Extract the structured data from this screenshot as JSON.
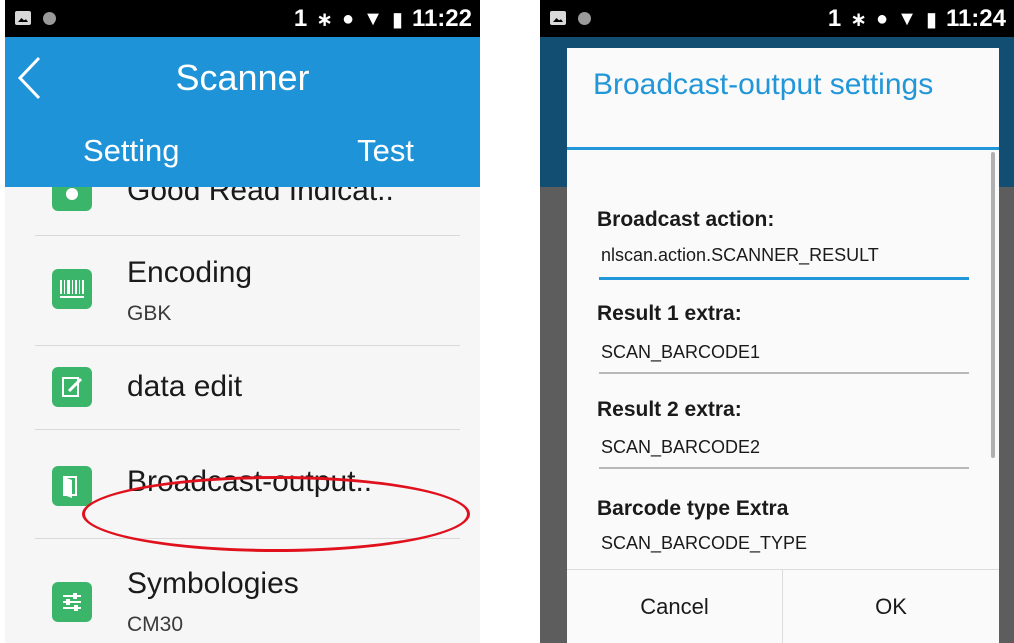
{
  "left_screen": {
    "status_bar": {
      "sim": "1",
      "time": "11:22",
      "icons": [
        "image-icon",
        "circle-icon",
        "bluetooth-icon",
        "alarm-icon",
        "wifi-icon",
        "battery-icon"
      ]
    },
    "app_bar": {
      "title": "Scanner",
      "back_icon": "chevron-left-icon"
    },
    "tabs": [
      {
        "label": "Setting"
      },
      {
        "label": "Test"
      }
    ],
    "list": [
      {
        "title": "Good Read Indicat..",
        "subtitle": "",
        "icon": "good-read-icon"
      },
      {
        "title": "Encoding",
        "subtitle": "GBK",
        "icon": "barcode-icon"
      },
      {
        "title": "data edit",
        "subtitle": "",
        "icon": "edit-icon"
      },
      {
        "title": "Broadcast-output..",
        "subtitle": "",
        "icon": "broadcast-icon"
      },
      {
        "title": "Symbologies",
        "subtitle": "CM30",
        "icon": "sliders-icon"
      }
    ],
    "highlight_color": "#e0101c"
  },
  "right_screen": {
    "status_bar": {
      "sim": "1",
      "time": "11:24"
    },
    "dialog": {
      "title": "Broadcast-output settings",
      "fields": [
        {
          "label": "Broadcast action:",
          "value": "nlscan.action.SCANNER_RESULT"
        },
        {
          "label": "Result 1 extra:",
          "value": "SCAN_BARCODE1"
        },
        {
          "label": "Result 2 extra:",
          "value": "SCAN_BARCODE2"
        },
        {
          "label": "Barcode type Extra",
          "value": "SCAN_BARCODE_TYPE"
        }
      ],
      "cancel_label": "Cancel",
      "ok_label": "OK"
    }
  },
  "colors": {
    "accent": "#1f93d8",
    "icon_green": "#3ab56a",
    "dialog_accent": "#2196d8",
    "scrim": "#5d5d5d"
  }
}
